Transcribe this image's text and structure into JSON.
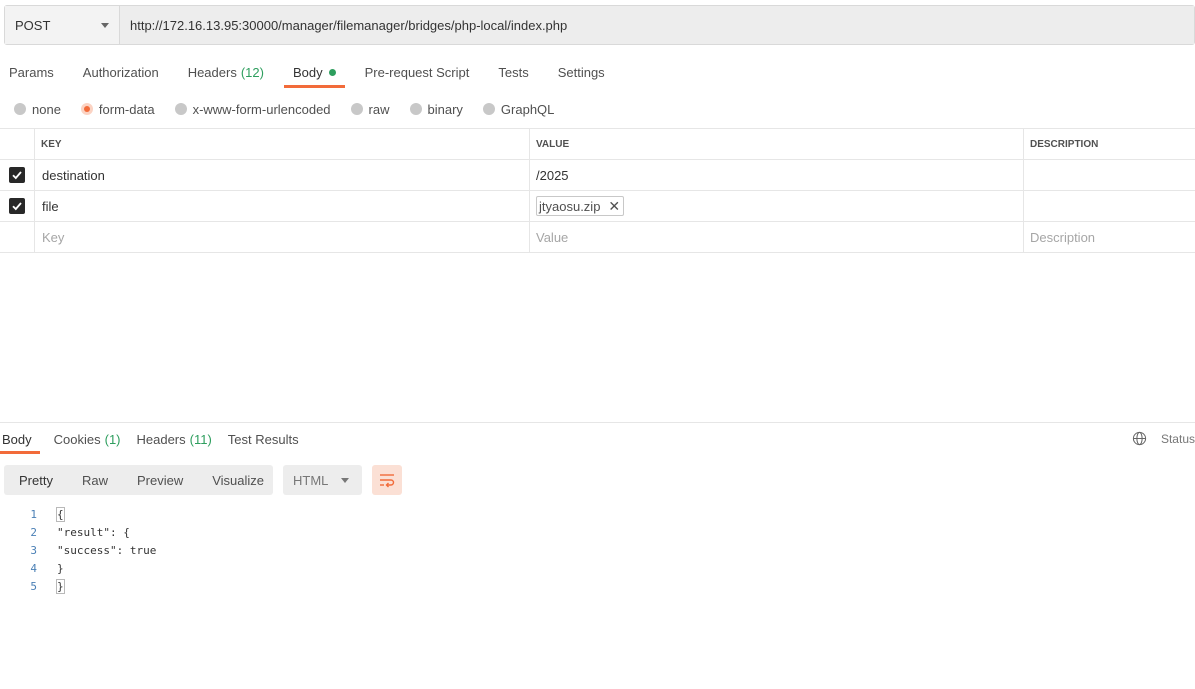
{
  "request": {
    "method": "POST",
    "url": "http://172.16.13.95:30000/manager/filemanager/bridges/php-local/index.php"
  },
  "request_tabs": [
    {
      "label": "Params",
      "count": ""
    },
    {
      "label": "Authorization",
      "count": ""
    },
    {
      "label": "Headers",
      "count": "(12)"
    },
    {
      "label": "Body",
      "count": ""
    },
    {
      "label": "Pre-request Script",
      "count": ""
    },
    {
      "label": "Tests",
      "count": ""
    },
    {
      "label": "Settings",
      "count": ""
    }
  ],
  "active_request_tab": "Body",
  "body_types": [
    "none",
    "form-data",
    "x-www-form-urlencoded",
    "raw",
    "binary",
    "GraphQL"
  ],
  "selected_body_type": "form-data",
  "table": {
    "headers": {
      "key": "KEY",
      "value": "VALUE",
      "description": "DESCRIPTION"
    },
    "rows": [
      {
        "checked": true,
        "key": "destination",
        "value": "/2025",
        "type": "text",
        "description": ""
      },
      {
        "checked": true,
        "key": "file",
        "value": "jtyaosu.zip",
        "type": "file",
        "description": ""
      }
    ],
    "placeholders": {
      "key": "Key",
      "value": "Value",
      "description": "Description"
    }
  },
  "response_tabs": [
    {
      "label": "Body",
      "count": ""
    },
    {
      "label": "Cookies",
      "count": "(1)"
    },
    {
      "label": "Headers",
      "count": "(11)"
    },
    {
      "label": "Test Results",
      "count": ""
    }
  ],
  "active_response_tab": "Body",
  "status_label": "Status",
  "view_modes": [
    "Pretty",
    "Raw",
    "Preview",
    "Visualize"
  ],
  "active_view_mode": "Pretty",
  "format": "HTML",
  "code_lines": [
    {
      "n": "1",
      "text": "{"
    },
    {
      "n": "2",
      "text": "\"result\": {"
    },
    {
      "n": "3",
      "text": "\"success\": true"
    },
    {
      "n": "4",
      "text": "}"
    },
    {
      "n": "5",
      "text": "}"
    }
  ],
  "colors": {
    "accent": "#f26b3a",
    "count_green": "#2e9e5e",
    "line_number_blue": "#4a7fb5"
  }
}
